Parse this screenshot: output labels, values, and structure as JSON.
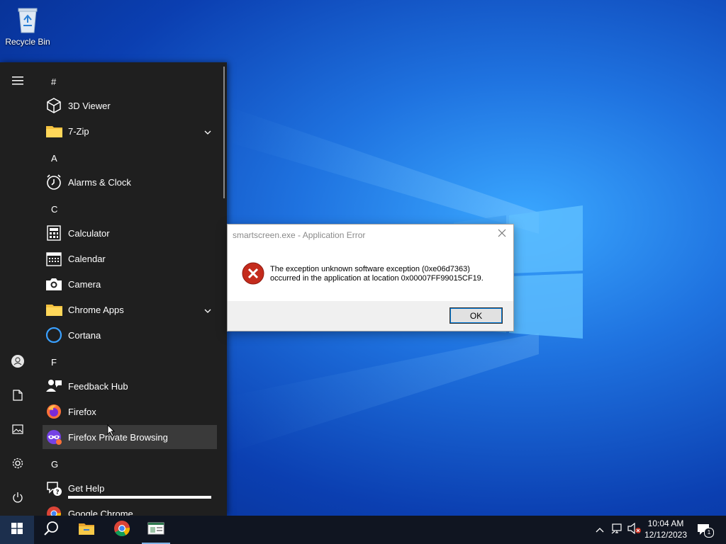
{
  "desktop": {
    "icons": [
      {
        "label": "Recycle Bin",
        "icon": "recycle-bin-icon"
      }
    ]
  },
  "start_menu": {
    "rail": [
      {
        "icon": "hamburger-menu-icon"
      },
      {
        "icon": "user-account-icon"
      },
      {
        "icon": "documents-icon"
      },
      {
        "icon": "pictures-icon"
      },
      {
        "icon": "settings-gear-icon"
      },
      {
        "icon": "power-icon"
      }
    ],
    "sections": [
      {
        "letter": "#"
      },
      {
        "letter": "A"
      },
      {
        "letter": "C"
      },
      {
        "letter": "F"
      },
      {
        "letter": "G"
      }
    ],
    "apps": [
      {
        "label": "3D Viewer",
        "icon": "cube-icon"
      },
      {
        "label": "7-Zip",
        "icon": "folder-icon",
        "expandable": true
      },
      {
        "label": "Alarms & Clock",
        "icon": "alarm-clock-icon"
      },
      {
        "label": "Calculator",
        "icon": "calculator-icon"
      },
      {
        "label": "Calendar",
        "icon": "calendar-icon"
      },
      {
        "label": "Camera",
        "icon": "camera-icon"
      },
      {
        "label": "Chrome Apps",
        "icon": "folder-icon",
        "expandable": true
      },
      {
        "label": "Cortana",
        "icon": "cortana-ring-icon"
      },
      {
        "label": "Feedback Hub",
        "icon": "feedback-hub-icon"
      },
      {
        "label": "Firefox",
        "icon": "firefox-icon"
      },
      {
        "label": "Firefox Private Browsing",
        "icon": "firefox-private-icon",
        "hovered": true
      },
      {
        "label": "Get Help",
        "icon": "get-help-icon"
      },
      {
        "label": "Google Chrome",
        "icon": "chrome-icon"
      }
    ]
  },
  "dialog": {
    "title": "smartscreen.exe - Application Error",
    "message_line1": "The exception unknown software exception (0xe06d7363)",
    "message_line2": "occurred in the application at location 0x00007FF99015CF19.",
    "ok_label": "OK",
    "icon": "error-x-icon"
  },
  "taskbar": {
    "items": [
      {
        "icon": "windows-start-icon"
      },
      {
        "icon": "search-icon"
      },
      {
        "icon": "file-explorer-icon"
      },
      {
        "icon": "chrome-icon"
      },
      {
        "icon": "app-window-icon",
        "active": true
      }
    ],
    "tray": [
      {
        "icon": "chevron-up-icon"
      },
      {
        "icon": "network-icon"
      },
      {
        "icon": "volume-muted-icon"
      },
      {
        "icon": "notifications-icon",
        "badge": "1"
      }
    ],
    "time": "10:04 AM",
    "date": "12/12/2023"
  },
  "colors": {
    "desktop_blue": "#0b3fb1",
    "start_menu_bg": "#1f1f1f",
    "taskbar_bg": "#101521",
    "error_red": "#c42b1c"
  }
}
